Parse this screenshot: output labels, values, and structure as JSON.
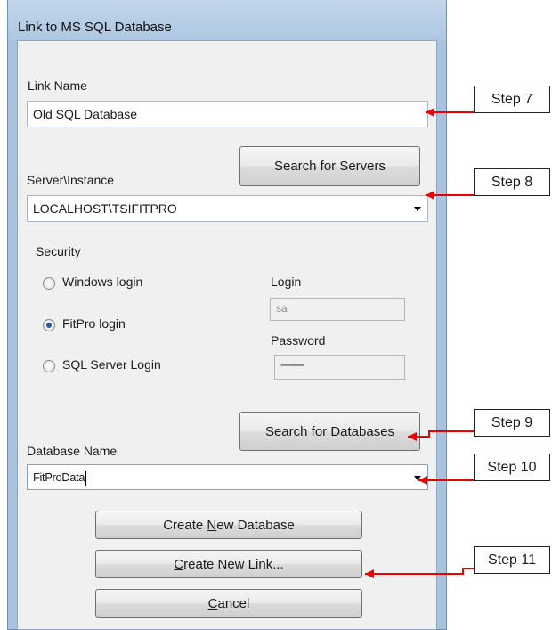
{
  "window": {
    "title": "Link to MS SQL Database"
  },
  "link_name": {
    "label": "Link Name",
    "value": "Old SQL Database"
  },
  "server": {
    "search_button": "Search for Servers",
    "label": "Server\\Instance",
    "value": "LOCALHOST\\TSIFITPRO"
  },
  "security": {
    "label": "Security",
    "options": [
      {
        "label": "Windows login",
        "selected": false
      },
      {
        "label": "FitPro login",
        "selected": true
      },
      {
        "label": "SQL Server Login",
        "selected": false
      }
    ],
    "login_label": "Login",
    "login_value": "sa",
    "password_label": "Password",
    "password_value": "••••••••••••"
  },
  "database": {
    "search_button": "Search for Databases",
    "label": "Database Name",
    "value": "FitProData"
  },
  "buttons": {
    "create_db": {
      "pre": "Create ",
      "key": "N",
      "post": "ew Database"
    },
    "create_link": {
      "pre": "",
      "key": "C",
      "post": "reate New Link..."
    },
    "cancel": {
      "pre": "",
      "key": "C",
      "post": "ancel"
    }
  },
  "annotations": {
    "callout_color": "#ee0000",
    "steps": [
      "Step 7",
      "Step 8",
      "Step 9",
      "Step 10",
      "Step 11"
    ]
  }
}
